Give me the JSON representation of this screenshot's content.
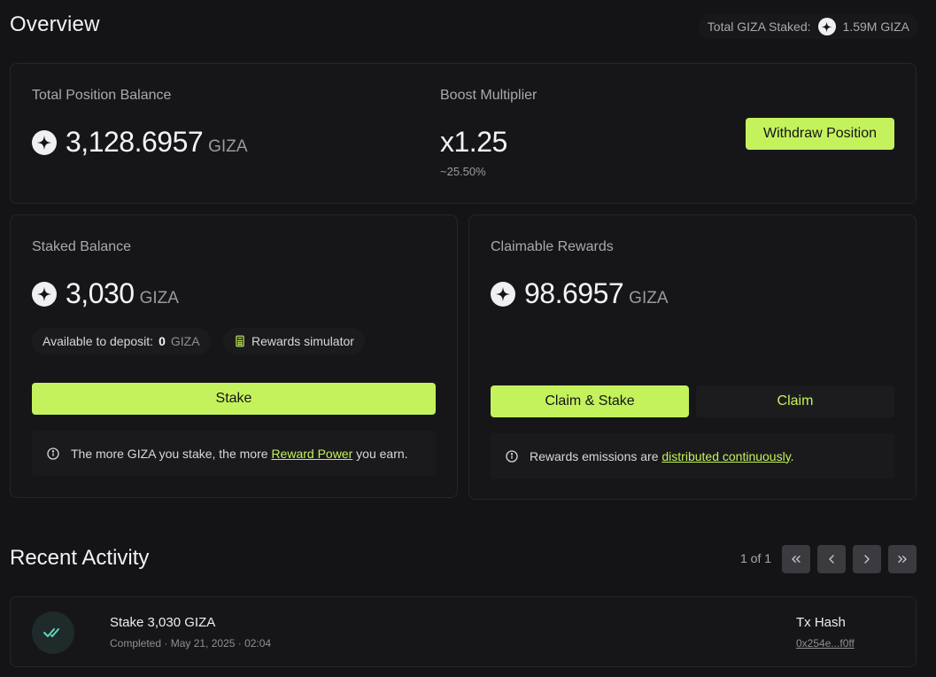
{
  "header": {
    "title": "Overview",
    "total_staked_label": "Total GIZA Staked:",
    "total_staked_value": "1.59M GIZA"
  },
  "position": {
    "balance_label": "Total Position Balance",
    "balance_value": "3,128.6957",
    "balance_unit": "GIZA",
    "boost_label": "Boost Multiplier",
    "boost_value": "x1.25",
    "boost_apr": "~25.50%",
    "withdraw_label": "Withdraw Position"
  },
  "staked": {
    "label": "Staked Balance",
    "value": "3,030",
    "unit": "GIZA",
    "available_label": "Available to deposit:",
    "available_value": "0",
    "available_unit": "GIZA",
    "simulator_label": "Rewards simulator",
    "stake_button": "Stake",
    "info_prefix": "The more GIZA you stake, the more ",
    "info_link": "Reward Power",
    "info_suffix": " you earn."
  },
  "rewards": {
    "label": "Claimable Rewards",
    "value": "98.6957",
    "unit": "GIZA",
    "claim_stake_button": "Claim & Stake",
    "claim_button": "Claim",
    "info_prefix": "Rewards emissions are ",
    "info_link": "distributed continuously",
    "info_suffix": "."
  },
  "activity": {
    "title": "Recent Activity",
    "page_text": "1 of 1",
    "items": [
      {
        "title": "Stake 3,030 GIZA",
        "subtitle": "Completed · May 21, 2025 · 02:04",
        "tx_label": "Tx Hash",
        "tx_hash": "0x254e...f0ff"
      }
    ]
  },
  "icons": {
    "giza_logo": "giza-star-icon",
    "calculator": "calculator-icon",
    "info": "info-icon",
    "check": "double-check-icon",
    "first": "chevrons-left-icon",
    "prev": "chevron-left-icon",
    "next": "chevron-right-icon",
    "last": "chevrons-right-icon"
  },
  "colors": {
    "accent": "#c4f25c",
    "background": "#141416",
    "card": "#161618",
    "success": "#5fd6b8"
  }
}
